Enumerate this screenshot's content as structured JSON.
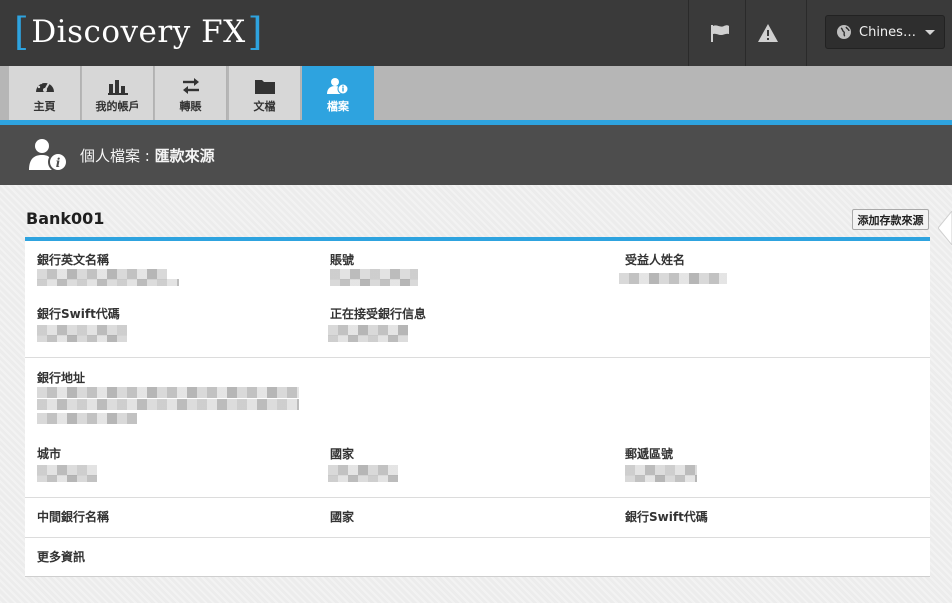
{
  "header": {
    "logo_bracket_open": "[",
    "logo_text": "Discovery FX",
    "logo_bracket_close": "]",
    "language": "Chines…",
    "icons": [
      "flag-icon",
      "warning-icon",
      "globe-icon",
      "chevron-down-icon"
    ]
  },
  "nav": {
    "tabs": [
      {
        "label": "主頁",
        "icon": "dashboard-icon"
      },
      {
        "label": "我的帳戶",
        "icon": "bar-chart-icon"
      },
      {
        "label": "轉賬",
        "icon": "transfer-icon"
      },
      {
        "label": "文檔",
        "icon": "folder-icon"
      },
      {
        "label": "檔案",
        "icon": "profile-info-icon",
        "active": true
      }
    ]
  },
  "page": {
    "title_prefix": "個人檔案 : ",
    "title_bold": "匯款來源"
  },
  "bank": {
    "name": "Bank001",
    "add_button": "添加存款來源",
    "fields": {
      "bank_english_name": "銀行英文名稱",
      "account_number": "賬號",
      "beneficiary_name": "受益人姓名",
      "bank_swift_code": "銀行Swift代碼",
      "receiving_bank_info": "正在接受銀行信息",
      "bank_address": "銀行地址",
      "city": "城市",
      "country": "國家",
      "postal_code": "郵遞區號",
      "intermediary_bank_name": "中間銀行名稱",
      "intermediary_country": "國家",
      "intermediary_swift_code": "銀行Swift代碼",
      "more_info": "更多資訊"
    }
  },
  "colors": {
    "accent": "#2ea3df",
    "topbar": "#3a3a3a",
    "page_header": "#4d4d4d",
    "nav_tab": "#d7d7d7"
  }
}
